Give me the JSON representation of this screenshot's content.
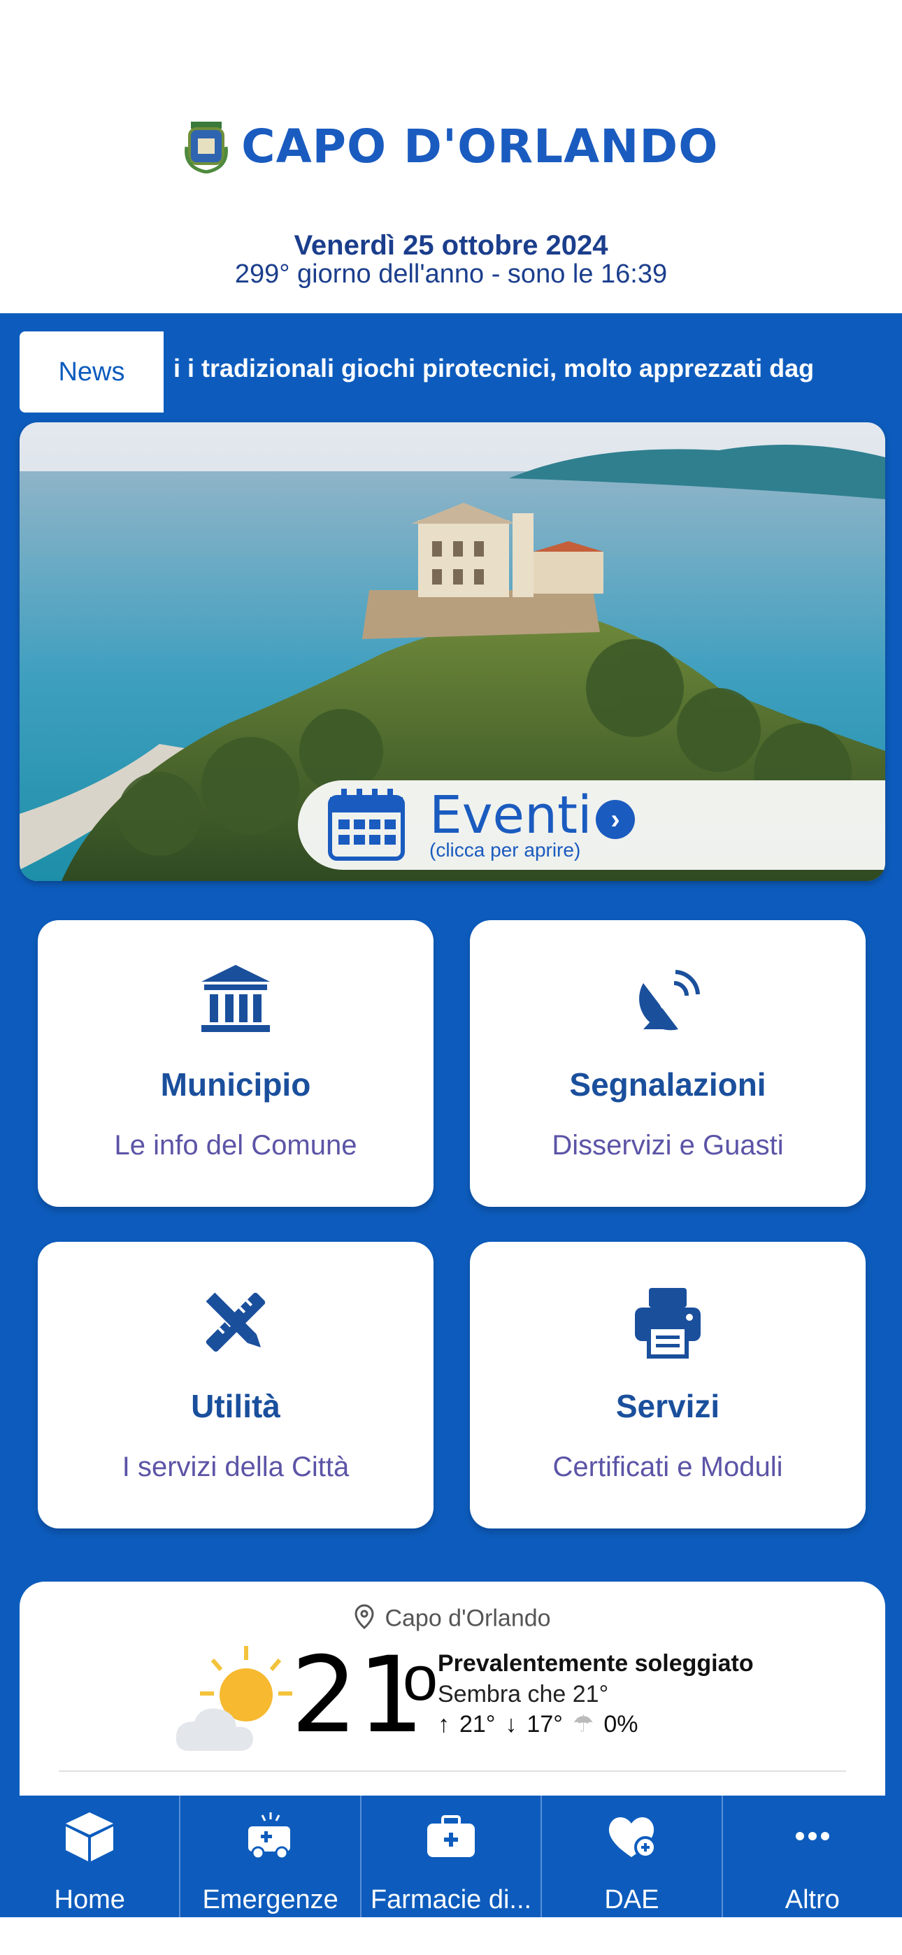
{
  "header": {
    "app_title": "CAPO D'ORLANDO",
    "date": "Venerdì 25 ottobre 2024",
    "day_info": "299° giorno dell'anno - sono le 16:39"
  },
  "news": {
    "badge": "News",
    "ticker": "i i tradizionali giochi pirotecnici, molto apprezzati dag"
  },
  "hero": {
    "label": "Eventi",
    "hint": "(clicca per aprire)"
  },
  "cards": [
    {
      "title": "Municipio",
      "subtitle": "Le info del Comune",
      "icon": "town-hall-icon"
    },
    {
      "title": "Segnalazioni",
      "subtitle": "Disservizi e Guasti",
      "icon": "satellite-dish-icon"
    },
    {
      "title": "Utilità",
      "subtitle": "I servizi della Città",
      "icon": "tools-icon"
    },
    {
      "title": "Servizi",
      "subtitle": "Certificati e Moduli",
      "icon": "printer-icon"
    }
  ],
  "weather": {
    "location": "Capo d'Orlando",
    "temperature": "21",
    "condition": "Prevalentemente soleggiato",
    "feels_like": "Sembra che 21°",
    "high": "21°",
    "low": "17°",
    "precip": "0%"
  },
  "tabs": [
    {
      "label": "Home",
      "icon": "box-icon"
    },
    {
      "label": "Emergenze",
      "icon": "ambulance-icon"
    },
    {
      "label": "Farmacie di...",
      "icon": "first-aid-kit-icon"
    },
    {
      "label": "DAE",
      "icon": "heart-plus-icon"
    },
    {
      "label": "Altro",
      "icon": "more-icon"
    }
  ],
  "colors": {
    "primary": "#0d5cbd",
    "accent": "#1a5bbf",
    "card_title": "#1a4f9c",
    "card_subtitle": "#5b54a6"
  }
}
